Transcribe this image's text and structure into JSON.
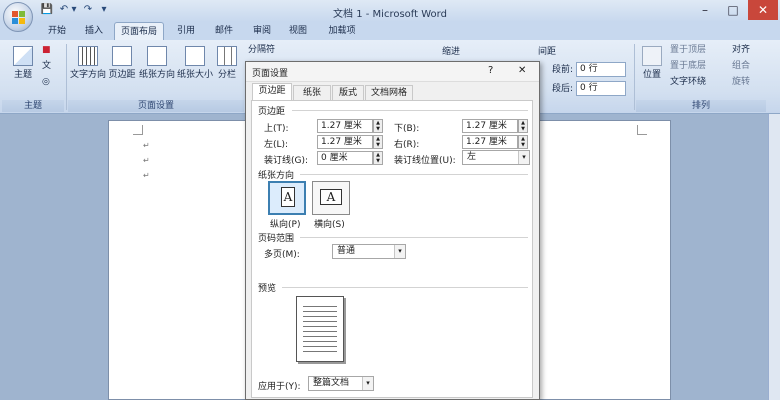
{
  "window": {
    "title": "文档 1 - Microsoft Word",
    "min": "–",
    "max": "□",
    "close": "✕"
  },
  "qat": {
    "save": "💾",
    "undo": "↶",
    "undo_drop": "▾",
    "redo": "↷",
    "customize": "▾"
  },
  "tabs": [
    {
      "label": "开始"
    },
    {
      "label": "插入"
    },
    {
      "label": "页面布局"
    },
    {
      "label": "引用"
    },
    {
      "label": "邮件"
    },
    {
      "label": "审阅"
    },
    {
      "label": "视图"
    },
    {
      "label": "加载项"
    }
  ],
  "ribbon": {
    "theme": {
      "label": "主题",
      "colors": "■",
      "fonts": "文",
      "effects": "◎",
      "group": "主题"
    },
    "page_setup": {
      "text_direction": "文字方向",
      "margins": "页边距",
      "orientation": "纸张方向",
      "size": "纸张大小",
      "columns": "分栏",
      "breaks": "分隔符",
      "group": "页面设置"
    },
    "paragraph": {
      "indent": "缩进",
      "spacing": "间距",
      "before_label": "段前:",
      "before_value": "0 行",
      "after_label": "段后:",
      "after_value": "0 行"
    },
    "arrange": {
      "position": "位置",
      "bring_front": "置于顶层",
      "send_back": "置于底层",
      "text_wrap": "文字环绕",
      "align": "对齐",
      "group_obj": "组合",
      "rotate": "旋转",
      "group": "排列"
    }
  },
  "dialog": {
    "title": "页面设置",
    "help": "?",
    "close": "✕",
    "tabs": [
      "页边距",
      "纸张",
      "版式",
      "文档网格"
    ],
    "margins_section": "页边距",
    "top_label": "上(T):",
    "top_value": "1.27 厘米",
    "bottom_label": "下(B):",
    "bottom_value": "1.27 厘米",
    "left_label": "左(L):",
    "left_value": "1.27 厘米",
    "right_label": "右(R):",
    "right_value": "1.27 厘米",
    "gutter_label": "装订线(G):",
    "gutter_value": "0 厘米",
    "gutter_pos_label": "装订线位置(U):",
    "gutter_pos_value": "左",
    "orientation_section": "纸张方向",
    "portrait": "纵向(P)",
    "landscape": "横向(S)",
    "orient_glyph": "A",
    "pages_section": "页码范围",
    "multi_label": "多页(M):",
    "multi_value": "普通",
    "preview_section": "预览",
    "apply_label": "应用于(Y):",
    "apply_value": "整篇文档"
  },
  "doc": {
    "marks": [
      "↵",
      "↵",
      "↵"
    ]
  },
  "icons": {
    "dropdown": "▾",
    "spin_up": "▲",
    "spin_down": "▼"
  }
}
